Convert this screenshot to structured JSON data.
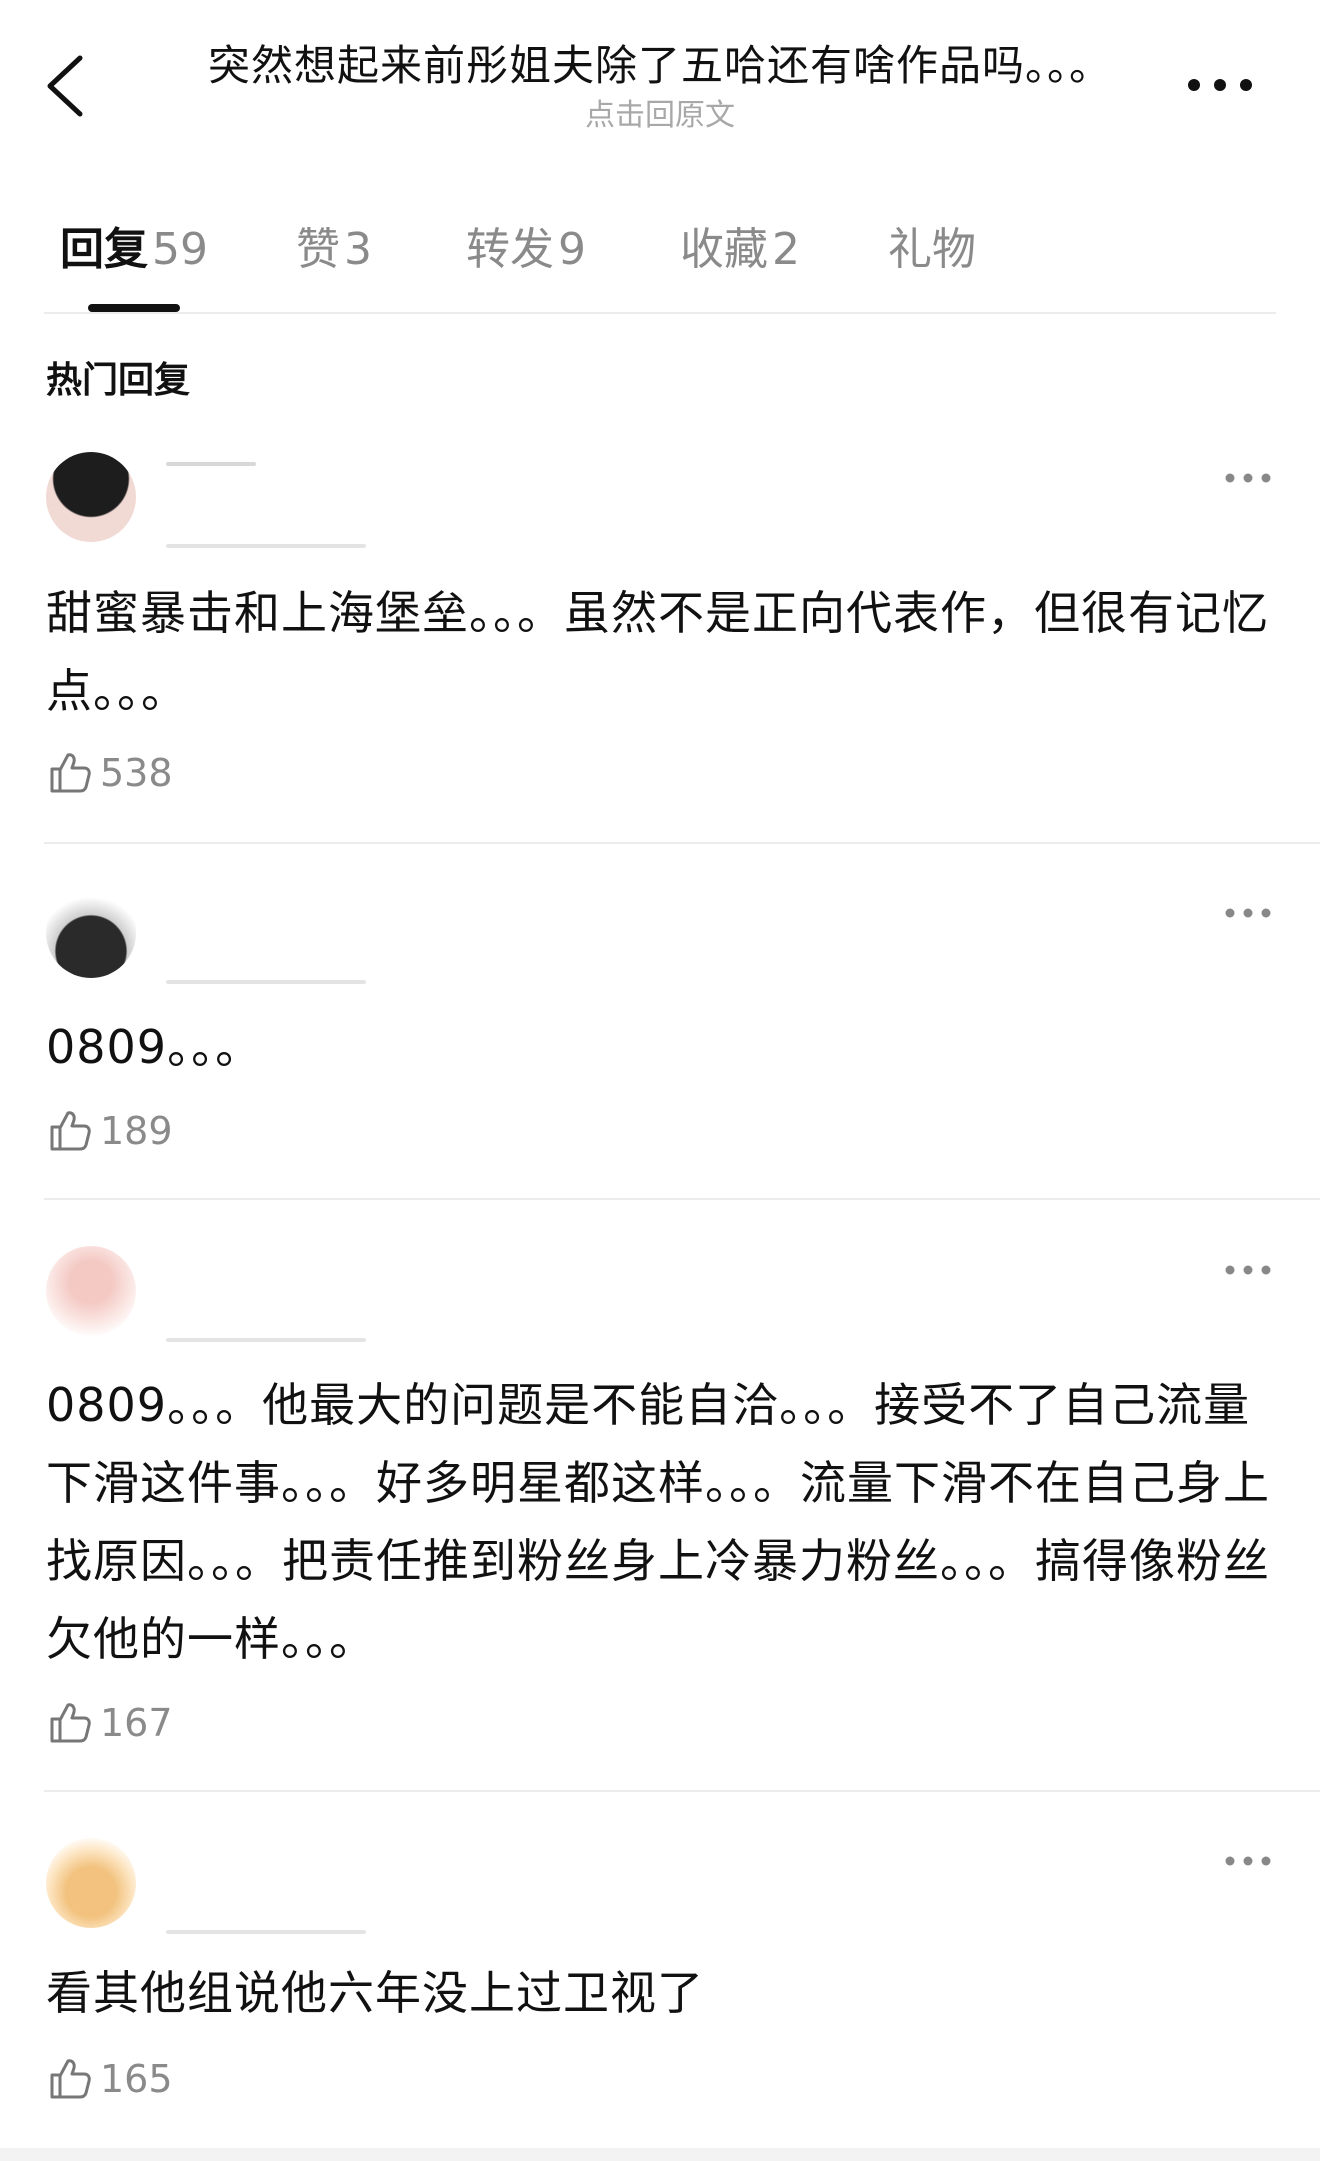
{
  "header": {
    "title": "突然想起来前彤姐夫除了五哈还有啥作品吗。。。",
    "subtitle": "点击回原文",
    "back_icon": "chevron-left-icon",
    "more_icon": "more-horizontal-icon"
  },
  "tabs": [
    {
      "label": "回复",
      "count": "59",
      "active": true
    },
    {
      "label": "赞",
      "count": "3",
      "active": false
    },
    {
      "label": "转发",
      "count": "9",
      "active": false
    },
    {
      "label": "收藏",
      "count": "2",
      "active": false
    },
    {
      "label": "礼物",
      "count": "",
      "active": false
    }
  ],
  "section": {
    "title": "热门回复"
  },
  "comments": [
    {
      "text": "甜蜜暴击和上海堡垒。。。虽然不是正向代表作，但很有记忆点。。。",
      "likes": "538"
    },
    {
      "text": "0809。。。",
      "likes": "189"
    },
    {
      "text": "0809。。。他最大的问题是不能自洽。。。接受不了自己流量下滑这件事。。。好多明星都这样。。。流量下滑不在自己身上找原因。。。把责任推到粉丝身上冷暴力粉丝。。。搞得像粉丝欠他的一样。。。",
      "likes": "167"
    },
    {
      "text": "看其他组说他六年没上过卫视了",
      "likes": "165"
    }
  ],
  "colors": {
    "text_primary": "#111111",
    "text_secondary": "#8a8a8a",
    "divider": "#ececec",
    "tab_indicator": "#111111"
  }
}
